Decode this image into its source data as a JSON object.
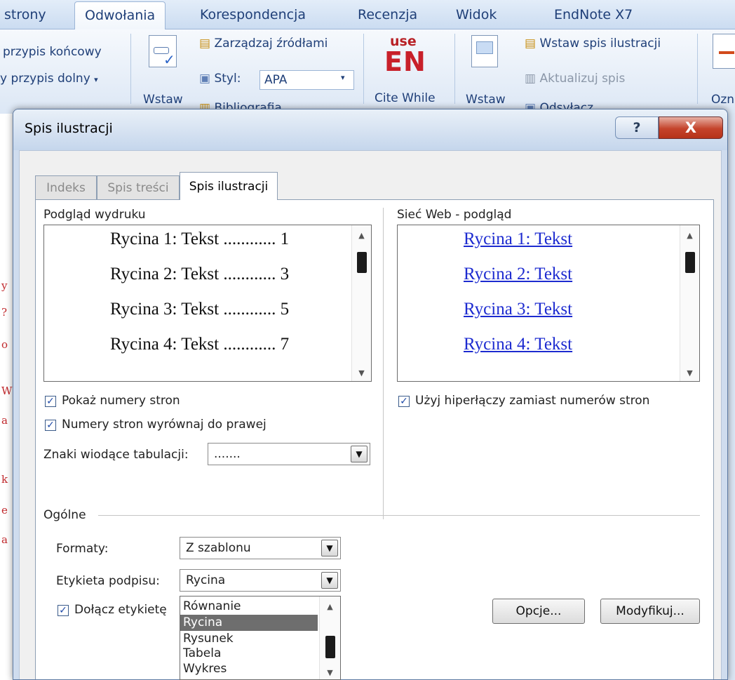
{
  "ribbon": {
    "tabs": [
      "strony",
      "Odwołania",
      "Korespondencja",
      "Recenzja",
      "Widok",
      "EndNote X7"
    ],
    "active_tab": "Odwołania",
    "footnotes": {
      "endnote": "przypis końcowy",
      "footnote": "y przypis dolny"
    },
    "citations": {
      "insert_label": "Wstaw",
      "manage_sources": "Zarządzaj źródłami",
      "style_label": "Styl:",
      "style_value": "APA",
      "bibliography": "Bibliografia"
    },
    "endnote": {
      "logo_top": "use",
      "logo_main": "EN",
      "cite_while": "Cite While"
    },
    "captions": {
      "insert_label": "Wstaw",
      "insert_toc_figures": "Wstaw spis ilustracji",
      "update_table": "Aktualizuj spis",
      "cross_ref": "Odsyłacz",
      "mark_label": "Ozn"
    }
  },
  "dialog": {
    "title": "Spis ilustracji",
    "help_label": "?",
    "close_label": "X",
    "tabs": [
      {
        "label": "Indeks",
        "active": false
      },
      {
        "label": "Spis treści",
        "active": false
      },
      {
        "label": "Spis ilustracji",
        "active": true
      }
    ],
    "print_preview": {
      "label": "Podgląd wydruku",
      "lines": [
        "Rycina 1: Tekst ............ 1",
        "Rycina 2: Tekst ............ 3",
        "Rycina 3: Tekst ............ 5",
        "Rycina 4: Tekst ............ 7"
      ]
    },
    "web_preview": {
      "label": "Sieć Web - podgląd",
      "lines": [
        "Rycina 1: Tekst",
        "Rycina 2: Tekst",
        "Rycina 3: Tekst",
        "Rycina 4: Tekst"
      ]
    },
    "options": {
      "show_page_numbers": {
        "label": "Pokaż numery stron",
        "checked": true
      },
      "right_align": {
        "label": "Numery stron wyrównaj do prawej",
        "checked": true
      },
      "tab_leader_label": "Znaki wiodące tabulacji:",
      "tab_leader_value": ".......",
      "use_hyperlinks": {
        "label": "Użyj hiperłączy zamiast numerów stron",
        "checked": true
      }
    },
    "general": {
      "header": "Ogólne",
      "formats_label": "Formaty:",
      "formats_value": "Z szablonu",
      "caption_label_label": "Etykieta podpisu:",
      "caption_label_value": "Rycina",
      "include_label": {
        "label": "Dołącz etykietę",
        "checked": true
      },
      "caption_options": [
        "Równanie",
        "Rycina",
        "Rysunek",
        "Tabela",
        "Wykres"
      ],
      "selected_option": "Rycina"
    },
    "buttons": {
      "options": "Opcje...",
      "modify": "Modyfikuj..."
    }
  }
}
